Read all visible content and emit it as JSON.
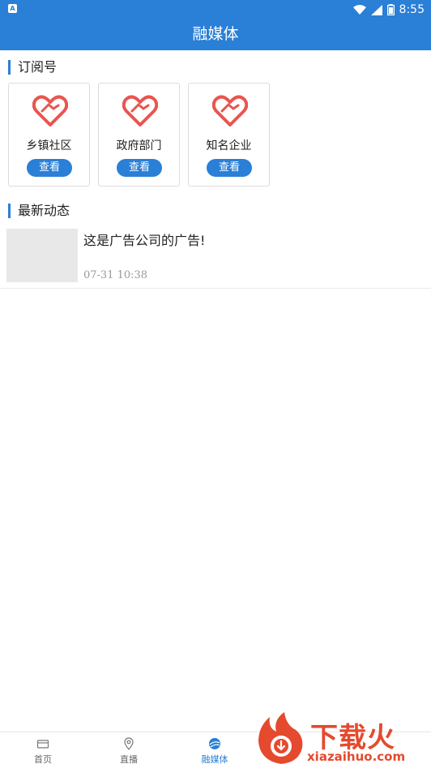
{
  "status_bar": {
    "time": "8:55",
    "app_badge": "A"
  },
  "header": {
    "title": "融媒体"
  },
  "subscriptions": {
    "title": "订阅号",
    "items": [
      {
        "name": "乡镇社区",
        "button": "查看"
      },
      {
        "name": "政府部门",
        "button": "查看"
      },
      {
        "name": "知名企业",
        "button": "查看"
      }
    ]
  },
  "latest": {
    "title": "最新动态",
    "items": [
      {
        "title": "这是广告公司的广告!",
        "time": "07-31  10:38"
      }
    ]
  },
  "tabs": [
    {
      "label": "首页",
      "icon": "home-card-icon"
    },
    {
      "label": "直播",
      "icon": "location-pin-icon"
    },
    {
      "label": "融媒体",
      "icon": "globe-icon",
      "active": true
    }
  ],
  "watermark": {
    "text": "下载火",
    "url": "xiazaihuo.com"
  },
  "colors": {
    "accent": "#2a7fd6",
    "heart": "#e8564f",
    "watermark": "#e54a2e"
  }
}
